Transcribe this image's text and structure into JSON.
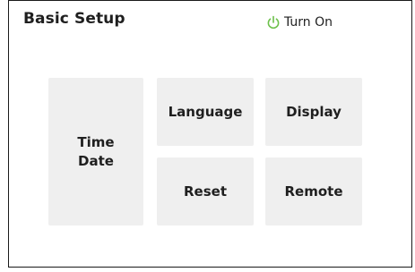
{
  "header": {
    "title": "Basic Setup",
    "power_label": "Turn On",
    "power_icon": "power-icon",
    "power_color": "#6cc04a"
  },
  "tiles": {
    "time_date": {
      "line1": "Time",
      "line2": "Date"
    },
    "language": "Language",
    "display": "Display",
    "reset": "Reset",
    "remote": "Remote"
  },
  "colors": {
    "tile_bg": "#efefef",
    "text": "#1f1f1f",
    "border": "#1a1a1a"
  }
}
